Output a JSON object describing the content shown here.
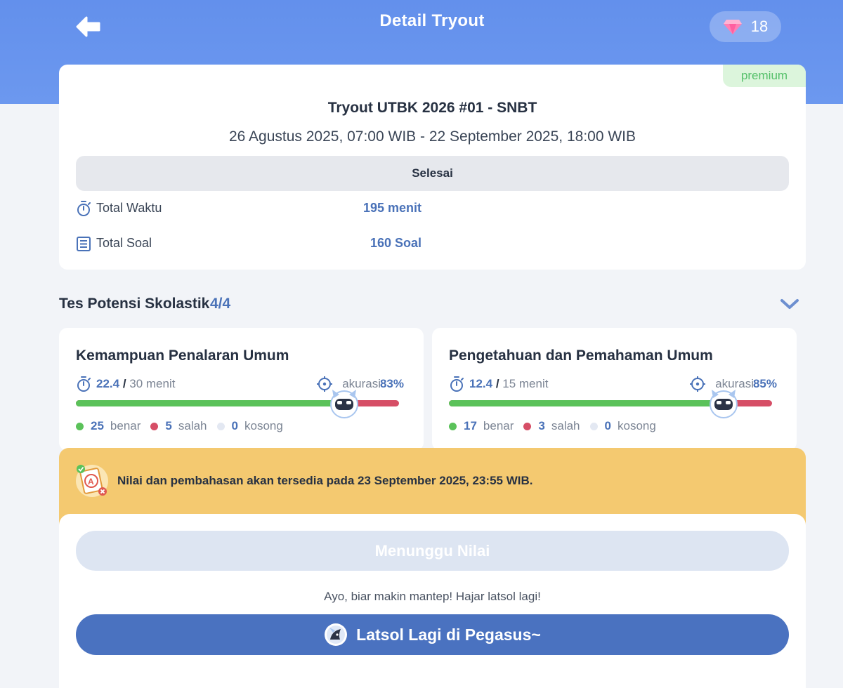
{
  "header": {
    "title": "Detail Tryout",
    "gem_count": "18",
    "back_icon": "arrow-left-icon",
    "gem_icon": "diamond-icon"
  },
  "tryout": {
    "badge": "premium",
    "name": "Tryout UTBK 2026 #01 - SNBT",
    "period": "26 Agustus 2025, 07:00 WIB - 22 September 2025, 18:00 WIB",
    "status": "Selesai",
    "total_time_label": "Total Waktu",
    "total_time_value": "195 menit",
    "total_questions_label": "Total Soal",
    "total_questions_value": "160 Soal"
  },
  "section": {
    "title": "Tes Potensi Skolastik",
    "count": "4/4",
    "subtests": [
      {
        "title": "Kemampuan Penalaran Umum",
        "time_spent": "22.4",
        "time_total": "30 menit",
        "accuracy_label": "akurasi",
        "accuracy_value": "83%",
        "accuracy": 0.83,
        "correct": "25",
        "correct_label": "benar",
        "wrong": "5",
        "wrong_label": "salah",
        "empty": "0",
        "empty_label": "kosong"
      },
      {
        "title": "Pengetahuan dan Pemahaman Umum",
        "time_spent": "12.4",
        "time_total": "15 menit",
        "accuracy_label": "akurasi",
        "accuracy_value": "85%",
        "accuracy": 0.85,
        "correct": "17",
        "correct_label": "benar",
        "wrong": "3",
        "wrong_label": "salah",
        "empty": "0",
        "empty_label": "kosong"
      }
    ]
  },
  "notice": {
    "text": "Nilai dan pembahasan akan tersedia pada 23 September 2025, 23:55 WIB."
  },
  "actions": {
    "wait_label": "Menunggu Nilai",
    "encourage_text": "Ayo, biar makin mantep! Hajar latsol lagi!",
    "latsol_label": "Latsol Lagi di Pegasus~"
  },
  "colors": {
    "header_blue": "#6390ec",
    "accent_blue": "#4a72b8",
    "correct_green": "#5bc25a",
    "wrong_red": "#d64e66",
    "notice_yellow": "#f4c970",
    "premium_green": "#55c06a"
  }
}
